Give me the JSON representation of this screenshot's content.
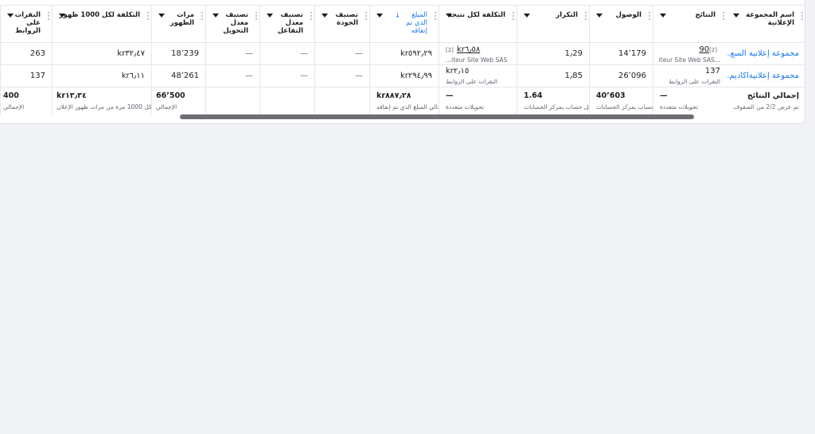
{
  "headers": {
    "ad_set_name": "اسم المجموعة الإعلانية",
    "results": "النتائج",
    "reach": "الوصول",
    "frequency": "التكرار",
    "cost_per_result": "التكلفة لكل نتيجة",
    "amount_spent": "المبلغ الذي تم إنفاقه",
    "quality_ranking": "تصنيف الجودة",
    "engagement_ranking": "تصنيف معدل التفاعل",
    "conversion_ranking": "تصنيف معدل التحويل",
    "impressions": "مرات الظهور",
    "cpm": "التكلفة لكل 1000 ظهور",
    "link_clicks": "النقرات على الروابط"
  },
  "rows": [
    {
      "name": "مجموعة إعلانية السع...",
      "results": "90",
      "results_badge": "[2]",
      "results_sub": "...iteur Site Web SAS",
      "reach": "14٬179",
      "frequency": "1٫29",
      "cost_per_result": "kr٦٫٥٨",
      "cost_badge": "[2]",
      "cost_sub": "...iteur Site Web SAS",
      "spent": "kr٥٩٢٫٢٩",
      "quality": "—",
      "engagement": "—",
      "conversion": "—",
      "impressions": "18٬239",
      "cpm": "kr٣٢٫٤٧",
      "clicks": "263"
    },
    {
      "name": "مجموعة إعلانيةاكاديم...",
      "results": "137",
      "results_badge": "",
      "results_sub": "النقرات على الروابط",
      "reach": "26٬096",
      "frequency": "1٫85",
      "cost_per_result": "kr٢٫١٥",
      "cost_badge": "",
      "cost_sub": "النقرات على الروابط",
      "spent": "kr٢٩٤٫٩٩",
      "quality": "—",
      "engagement": "—",
      "conversion": "—",
      "impressions": "48٬261",
      "cpm": "kr٦٫١١",
      "clicks": "137"
    }
  ],
  "totals": {
    "label": "إجمالي النتائج",
    "label_sub": "تم عرض 2/2 من الصفوف",
    "results": "—",
    "results_sub": "تحويلات متعددة",
    "reach": "40٬603",
    "reach_sub": "حساب بمركز الحسابات",
    "frequency": "1.64",
    "frequency_sub": "لكل حساب بمركز الحسابات",
    "cost_per_result": "—",
    "cost_sub": "تحويلات متعددة",
    "spent": "kr٨٨٧٫٢٨",
    "spent_sub": "إجمالي المبلغ الذي تم إنفاقه",
    "impressions": "66٬500",
    "impressions_sub": "الإجمالي",
    "cpm": "kr١٣٫٣٤",
    "cpm_sub": "لكل 1000 مرة من مرات ظهور الإعلان",
    "clicks": "400",
    "clicks_sub": "الإجمالي"
  },
  "colors": {
    "link": "#1877f2",
    "border": "#e4e6eb",
    "background": "#f0f2f5",
    "scrollbar": "#6e7075"
  }
}
